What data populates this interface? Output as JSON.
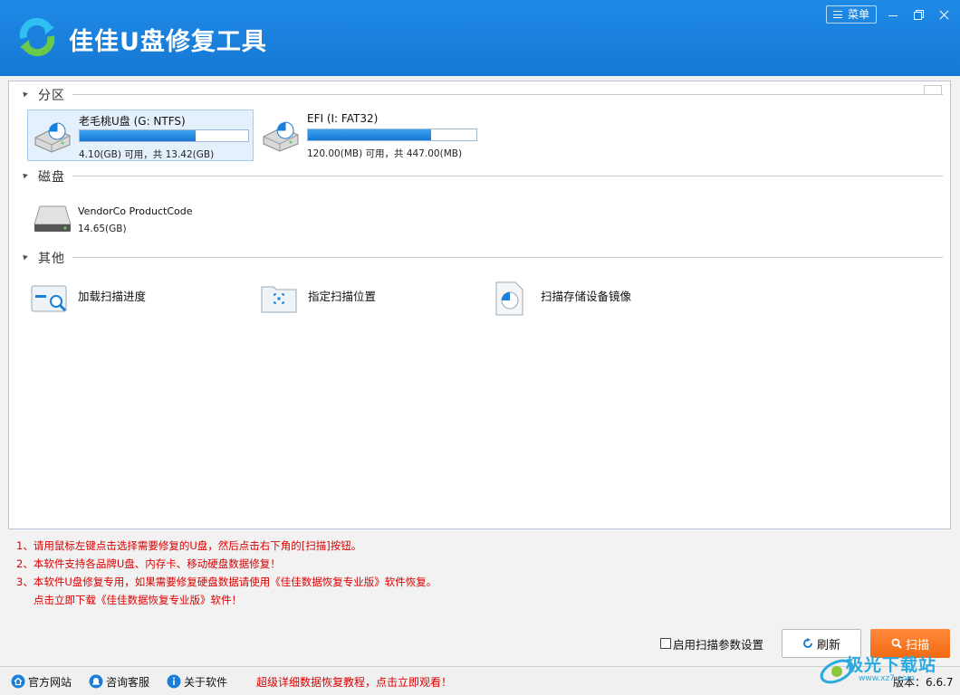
{
  "app": {
    "title": "佳佳U盘修复工具",
    "menu_label": "菜单"
  },
  "sections": {
    "partition": "分区",
    "disk": "磁盘",
    "other": "其他"
  },
  "partitions": [
    {
      "name": "老毛桃U盘 (G: NTFS)",
      "capacity": "4.10(GB) 可用，共 13.42(GB)",
      "used_fraction": 0.69,
      "selected": true
    },
    {
      "name": "EFI (I: FAT32)",
      "capacity": "120.00(MB) 可用，共 447.00(MB)",
      "used_fraction": 0.73,
      "selected": false
    }
  ],
  "disks": [
    {
      "name": "VendorCo ProductCode",
      "size": "14.65(GB)"
    }
  ],
  "others": [
    {
      "label": "加载扫描进度",
      "icon": "scan-progress-icon"
    },
    {
      "label": "指定扫描位置",
      "icon": "scan-location-icon"
    },
    {
      "label": "扫描存储设备镜像",
      "icon": "device-image-icon"
    }
  ],
  "notes": [
    "1、请用鼠标左键点击选择需要修复的U盘，然后点击右下角的[扫描]按钮。",
    "2、本软件支持各品牌U盘、内存卡、移动硬盘数据修复！",
    "3、本软件U盘修复专用，如果需要修复硬盘数据请使用《佳佳数据恢复专业版》软件恢复。",
    "点击立即下载《佳佳数据恢复专业版》软件！"
  ],
  "actions": {
    "scan_options_label": "启用扫描参数设置",
    "scan_options_checked": false,
    "refresh_label": "刷新",
    "scan_label": "扫描"
  },
  "statusbar": {
    "official_site": "官方网站",
    "consult": "咨询客服",
    "about": "关于软件",
    "promo": "超级详细数据恢复教程，点击立即观看！",
    "version": "版本：6.6.7"
  },
  "watermark": {
    "text": "极光下载站",
    "url": "www.xz7.com"
  },
  "colors": {
    "titlebar": "#1880dd",
    "accent_orange": "#f47a24",
    "note_red": "#dd0000"
  }
}
